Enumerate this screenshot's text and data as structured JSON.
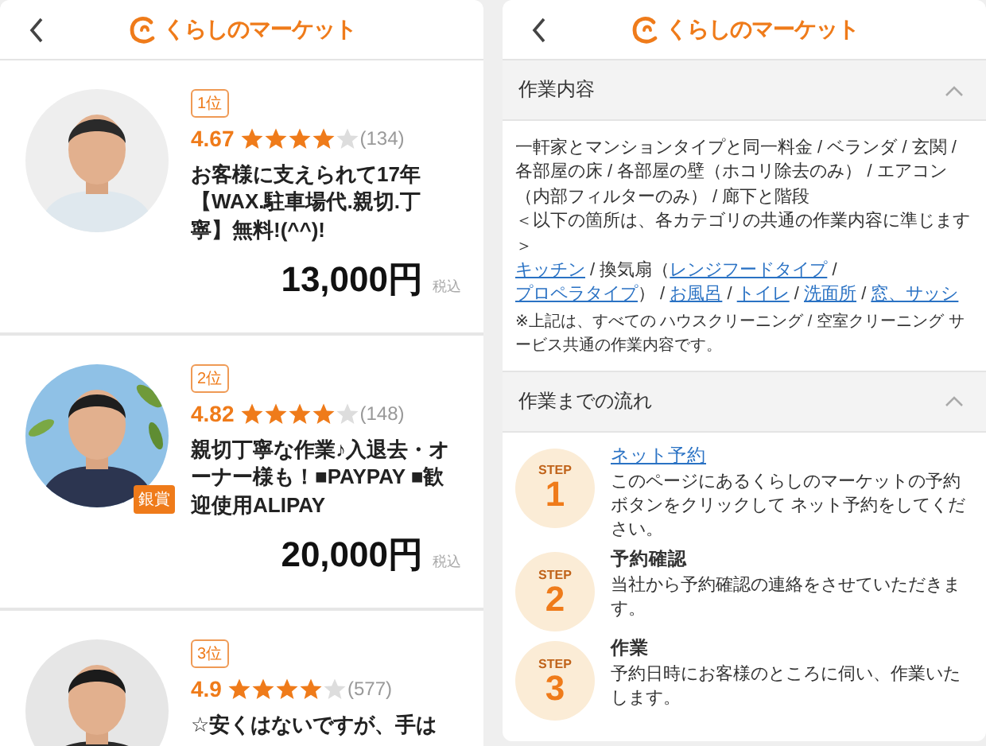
{
  "left_panel": {
    "logo": "くらしのマーケット",
    "providers": [
      {
        "rank": "1位",
        "rating": "4.67",
        "stars": 4,
        "review_count": "(134)",
        "title": "お客様に支えられて17年【WAX.駐車場代.親切.丁寧】無料!(^^)!",
        "price": "13,000円",
        "tax_note": "税込"
      },
      {
        "rank": "2位",
        "award": "銀賞",
        "rating": "4.82",
        "stars": 4,
        "review_count": "(148)",
        "title": "親切丁寧な作業♪入退去・オーナー様も！■PAYPAY ■歓迎使用ALIPAY",
        "price": "20,000円",
        "tax_note": "税込"
      },
      {
        "rank": "3位",
        "rating": "4.9",
        "stars": 4,
        "review_count": "(577)",
        "title": "☆安くはないですが、手は"
      }
    ]
  },
  "right_panel": {
    "logo": "くらしのマーケット",
    "sections": [
      {
        "kind": "content",
        "title": "作業内容",
        "expanded": true,
        "paragraphs": [
          [
            {
              "text": "一軒家とマンションタイプと同一料金 / ベランダ / 玄関 / 各部屋の床 / 各部屋の壁（ホコリ除去のみ） / エアコン（内部フィルターのみ） / 廊下と階段",
              "link": false
            }
          ],
          [
            {
              "text": "＜以下の箇所は、各カテゴリの共通の作業内容に準じます＞",
              "link": false
            }
          ],
          [
            {
              "text": "キッチン",
              "link": true
            },
            {
              "text": " / 換気扇（",
              "link": false
            },
            {
              "text": "レンジフードタイプ",
              "link": true
            },
            {
              "text": " / ",
              "link": false
            },
            {
              "text": "プロペラタイプ",
              "link": true
            },
            {
              "text": "） / ",
              "link": false
            },
            {
              "text": "お風呂",
              "link": true
            },
            {
              "text": " / ",
              "link": false
            },
            {
              "text": "トイレ",
              "link": true
            },
            {
              "text": " / ",
              "link": false
            },
            {
              "text": "洗面所",
              "link": true
            },
            {
              "text": " / ",
              "link": false
            },
            {
              "text": "窓、サッシ",
              "link": true
            }
          ]
        ],
        "note": "※上記は、すべての ハウスクリーニング / 空室クリーニング サービス共通の作業内容です。"
      },
      {
        "kind": "steps",
        "title": "作業までの流れ",
        "expanded": true,
        "steps": [
          {
            "label": "STEP",
            "number": "1",
            "title": "ネット予約",
            "link": true,
            "text": "このページにあるくらしのマーケットの予約ボタンをクリックして ネット予約をしてください。"
          },
          {
            "label": "STEP",
            "number": "2",
            "title": "予約確認",
            "link": false,
            "text": "当社から予約確認の連絡をさせていただきます。"
          },
          {
            "label": "STEP",
            "number": "3",
            "title": "作業",
            "link": false,
            "text": "予約日時にお客様のところに伺い、作業いたします。"
          }
        ]
      }
    ]
  }
}
